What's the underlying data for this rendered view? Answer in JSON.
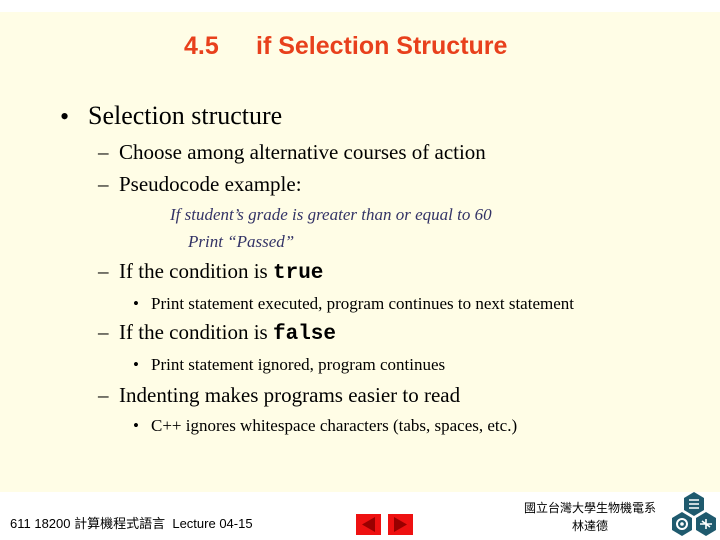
{
  "slide": {
    "title_number": "4.5",
    "title_text": "if Selection Structure",
    "bullets": {
      "b1": "Selection structure",
      "b1_1": "Choose among alternative courses of action",
      "b1_2": "Pseudocode example:",
      "pseudo_1": "If student’s grade is greater than or equal to 60",
      "pseudo_2": "Print “Passed”",
      "b1_3_prefix": "If the condition is ",
      "b1_3_code": "true",
      "b1_3_1": "Print statement executed, program continues to next statement",
      "b1_4_prefix": "If the condition is ",
      "b1_4_code": "false",
      "b1_4_1": "Print statement ignored, program continues",
      "b1_5": "Indenting makes programs easier to read",
      "b1_5_1": "C++ ignores whitespace characters (tabs, spaces, etc.)"
    },
    "markers": {
      "bullet": "•",
      "dash": "–"
    }
  },
  "footer": {
    "course": "611 18200 計算機程式語言",
    "lecture": "Lecture 04-15",
    "institution_line1": "國立台灣大學生物機電系",
    "institution_line2": "林達德",
    "prev_label": "previous",
    "next_label": "next"
  },
  "colors": {
    "title": "#e8401c",
    "background": "#fffde6",
    "pseudocode": "#333366",
    "nav": "#ee1111",
    "logo": "#1f5a6e"
  }
}
